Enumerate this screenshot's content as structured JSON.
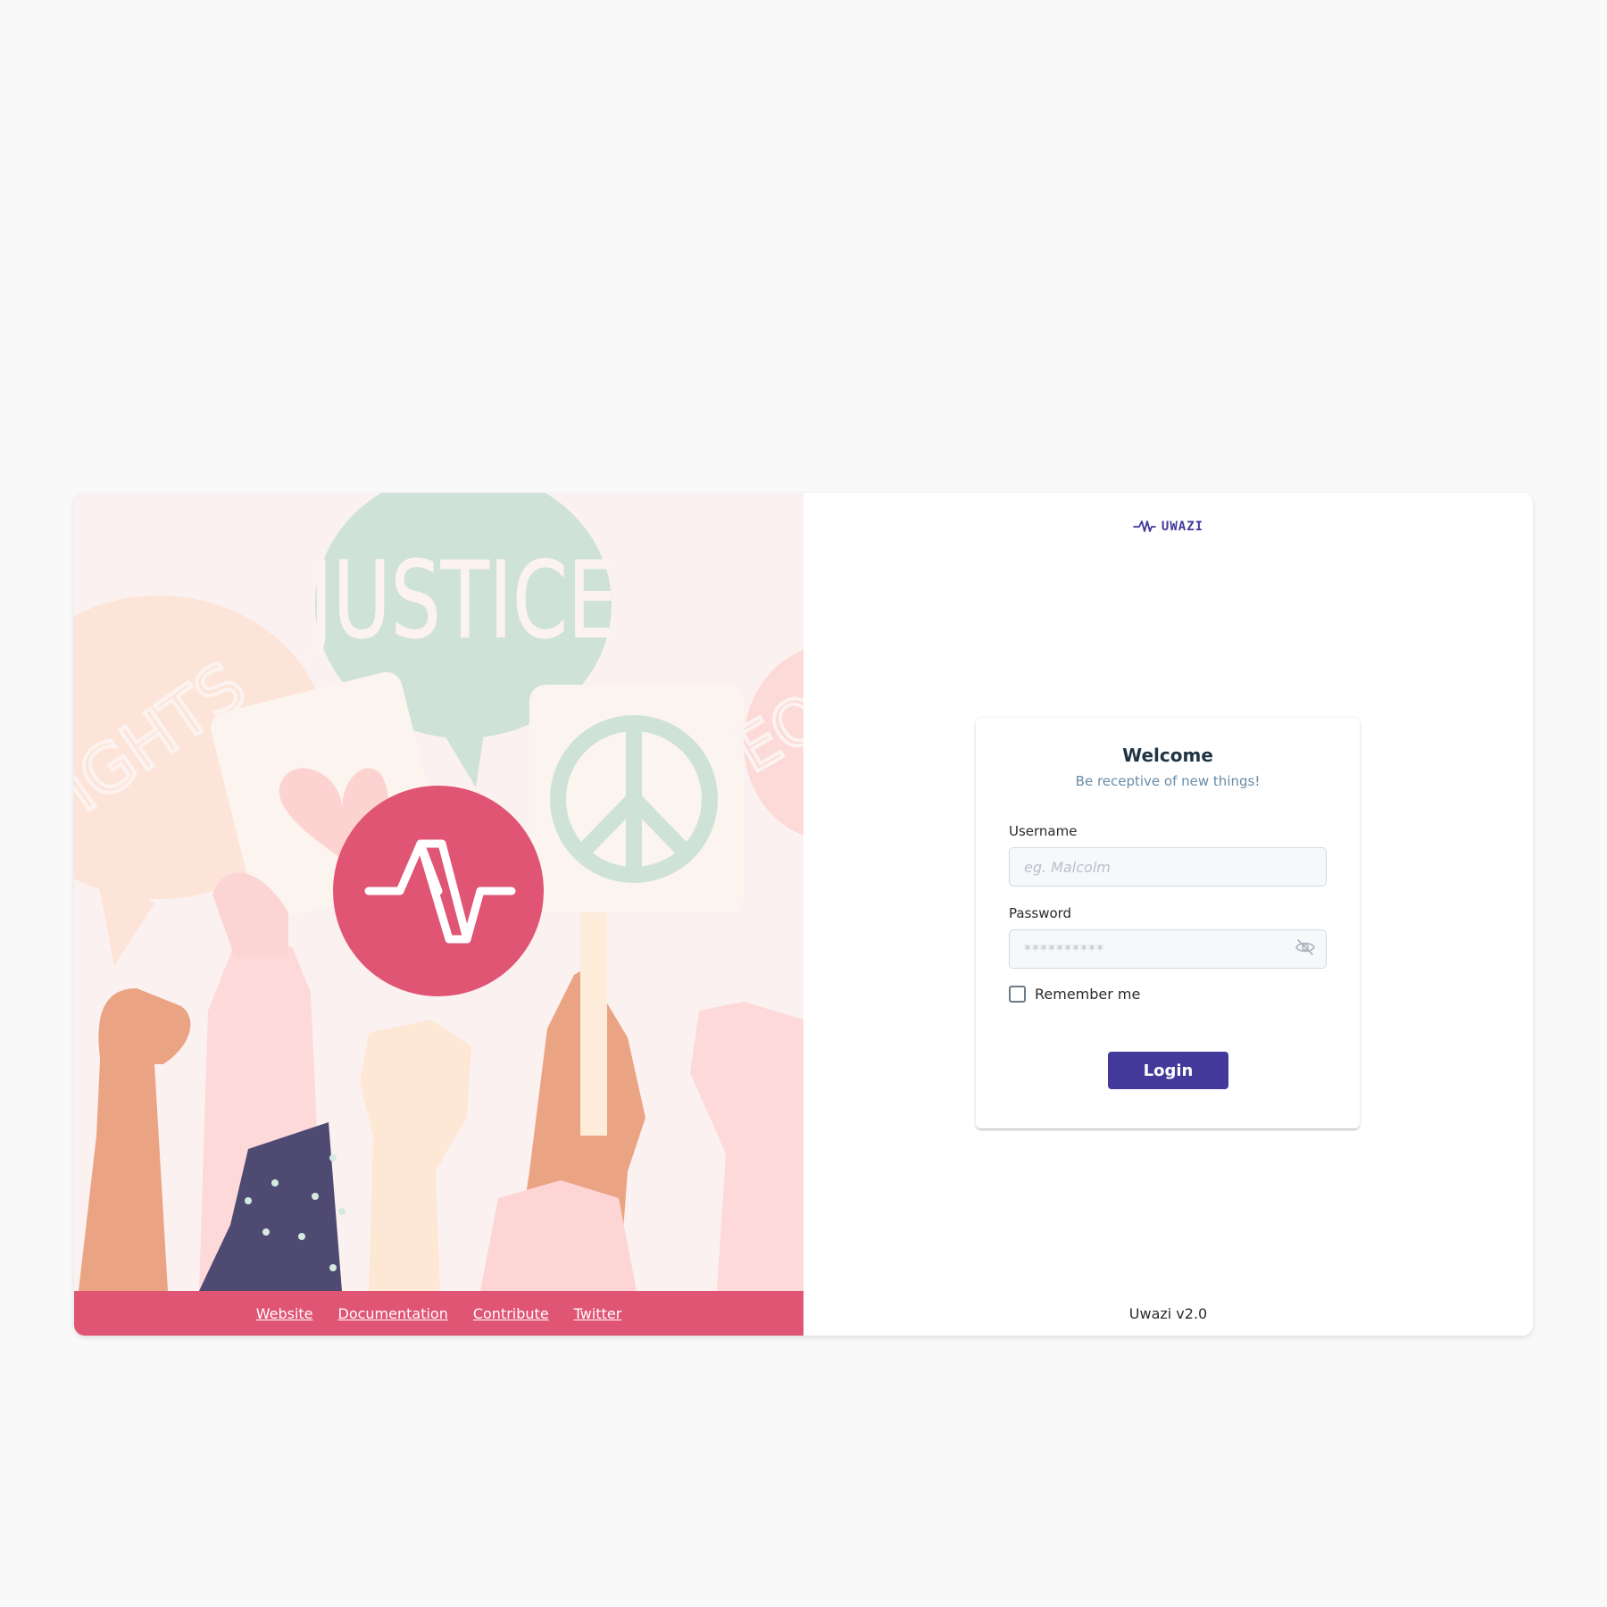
{
  "colors": {
    "page_bg": "#f9f9f9",
    "brand_purple": "#42399a",
    "brand_pink": "#e05474",
    "illustration_bg": "#fcf1f1",
    "mint": "#cfe2d8"
  },
  "illustration": {
    "bubble_justice": "JUSTICE",
    "bubble_rights": "IAN IGHTS",
    "bubble_eq": "EQ",
    "logo_icon": "uwazi-pulse-icon"
  },
  "footer": {
    "links": [
      "Website",
      "Documentation",
      "Contribute",
      "Twitter"
    ]
  },
  "brand": {
    "name": "UWAZI",
    "icon": "uwazi-pulse-icon"
  },
  "login": {
    "title": "Welcome",
    "tagline": "Be receptive of new things!",
    "username_label": "Username",
    "username_placeholder": "eg. Malcolm",
    "password_label": "Password",
    "password_placeholder": "**********",
    "password_toggle_icon": "eye-slash-icon",
    "remember_label": "Remember me",
    "remember_checked": false,
    "submit_label": "Login"
  },
  "version": "Uwazi v2.0"
}
